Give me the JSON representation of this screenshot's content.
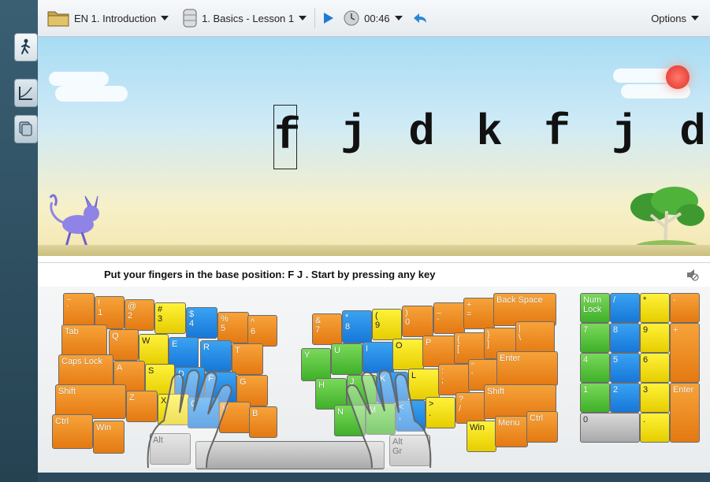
{
  "toolbar": {
    "course_label": "EN 1. Introduction",
    "lesson_label": "1. Basics - Lesson 1",
    "timer": "00:46",
    "options_label": "Options"
  },
  "sidebar": {
    "items": [
      {
        "name": "exercise",
        "icon": "walking-figure-icon"
      },
      {
        "name": "statistics",
        "icon": "chart-icon"
      },
      {
        "name": "lessons",
        "icon": "stack-icon"
      }
    ]
  },
  "exercise": {
    "letters": [
      "f",
      "j",
      "d",
      "k",
      "f",
      "j",
      "d"
    ],
    "current_index": 0
  },
  "status": {
    "text": "Put your fingers in the base position:  F  J .  Start by pressing any key"
  },
  "keyboard": {
    "left_rows": [
      [
        "~\n`",
        "!\n1",
        "@\n2",
        "#\n3",
        "$\n4",
        "%\n5",
        "^\n6"
      ],
      [
        "Tab",
        "Q",
        "W",
        "E",
        "R",
        "T"
      ],
      [
        "Caps Lock",
        "A",
        "S",
        "D",
        "F",
        "G"
      ],
      [
        "Shift",
        "Z",
        "X",
        "C",
        "V",
        "B"
      ],
      [
        "Ctrl",
        "Win",
        "Alt"
      ]
    ],
    "right_rows": [
      [
        "&\n7",
        "*\n8",
        "(\n9",
        ")\n0",
        "_\n-",
        "+\n=",
        "Back Space"
      ],
      [
        "Y",
        "U",
        "I",
        "O",
        "P",
        "{\n[",
        "}\n]",
        "|\n\\"
      ],
      [
        "H",
        "J",
        "K",
        "L",
        ":\n;",
        "\"\n'",
        "Enter"
      ],
      [
        "N",
        "M",
        "<\n,",
        ">\n.",
        "?\n/",
        "Shift"
      ],
      [
        "Alt\nGr",
        "Win",
        "Menu",
        "Ctrl"
      ]
    ],
    "numpad": [
      "Num\nLock",
      "/",
      "*",
      "-",
      "7",
      "8",
      "9",
      "+",
      "4",
      "5",
      "6",
      "1",
      "2",
      "3",
      "Enter",
      "0",
      "."
    ]
  }
}
